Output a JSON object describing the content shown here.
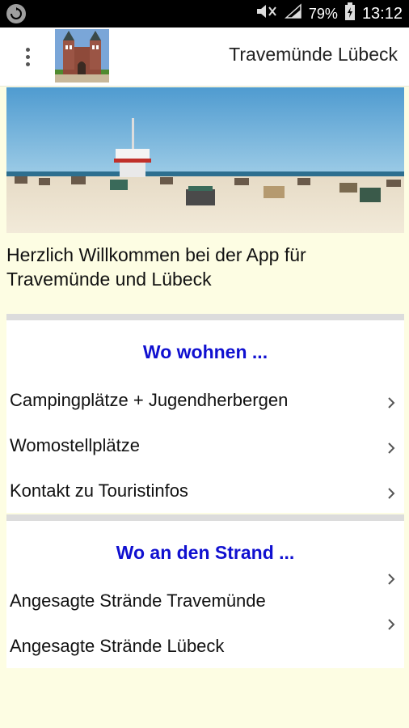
{
  "status_bar": {
    "battery_percent": "79%",
    "time": "13:12",
    "icons": [
      "sync-icon",
      "mute-icon",
      "signal-icon",
      "battery-icon"
    ]
  },
  "app_bar": {
    "title": "Travemünde Lübeck",
    "menu_icon": "overflow-menu-icon",
    "logo": "holstentor-logo"
  },
  "hero": {
    "image": "beach-with-lifeguard-tower"
  },
  "welcome_text": "Herzlich Willkommen bei der App für Travemünde und Lübeck",
  "sections": [
    {
      "title": "Wo wohnen ...",
      "items": [
        {
          "label": "Campingplätze + Jugendherbergen"
        },
        {
          "label": "Womostellplätze"
        },
        {
          "label": "Kontakt zu Touristinfos"
        }
      ]
    },
    {
      "title": "Wo an den Strand ...",
      "items": [
        {
          "label": "Angesagte Strände Travemünde"
        },
        {
          "label": "Angesagte Strände Lübeck"
        }
      ]
    }
  ],
  "colors": {
    "background": "#fdfde3",
    "section_title": "#1010d0",
    "status_bar": "#000000"
  }
}
